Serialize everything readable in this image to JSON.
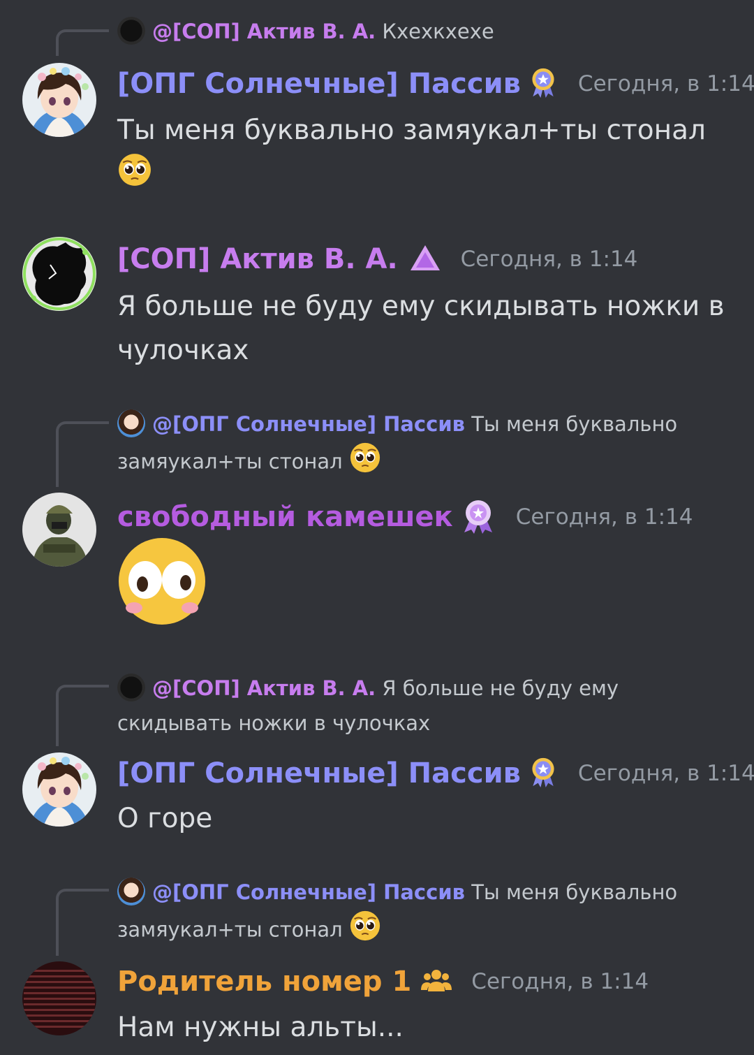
{
  "colors": {
    "background": "#313338",
    "passiv_name": "#8c8ff8",
    "aktiv_name": "#c77dee",
    "kameshek_name": "#b55ce0",
    "roditel_name": "#f0a33a",
    "timestamp": "#949ba4",
    "text": "#dbdee1"
  },
  "messages": [
    {
      "reply": {
        "mention": "@[СОП] Актив В. А.",
        "text": "Кхехкхехе",
        "avatar_icon": "dark-silhouette-avatar"
      },
      "author": "[ОПГ Солнечные] Пассив",
      "badge_icon": "rosette-badge-icon",
      "time": "Сегодня, в 1:14",
      "text": "Ты меня буквально замяукал+ты стонал",
      "emoji": "pleading-face-emoji"
    },
    {
      "author": "[СОП] Актив В. А.",
      "badge_icon": "triangle-badge-icon",
      "time": "Сегодня, в 1:14",
      "text": "Я больше не буду ему скидывать ножки в чулочках"
    },
    {
      "reply": {
        "mention": "@[ОПГ Солнечные] Пассив",
        "text": "Ты меня буквально замяукал+ты стонал",
        "avatar_icon": "anime-girl-avatar"
      },
      "author": "свободный камешек",
      "badge_icon": "flower-badge-icon",
      "time": "Сегодня, в 1:14",
      "emoji": "flushed-face-emoji"
    },
    {
      "reply": {
        "mention": "@[СОП] Актив В. А.",
        "text": "Я больше не буду ему скидывать ножки в чулочках",
        "avatar_icon": "dark-silhouette-avatar"
      },
      "author": "[ОПГ Солнечные] Пассив",
      "badge_icon": "rosette-badge-icon",
      "time": "Сегодня, в 1:14",
      "text": "О горе"
    },
    {
      "reply": {
        "mention": "@[ОПГ Солнечные] Пассив",
        "text": "Ты меня буквально замяукал+ты стонал",
        "avatar_icon": "anime-girl-avatar"
      },
      "author": "Родитель номер 1",
      "badge_icon": "people-badge-icon",
      "time": "Сегодня, в 1:14",
      "text": "Нам нужны альты..."
    }
  ]
}
